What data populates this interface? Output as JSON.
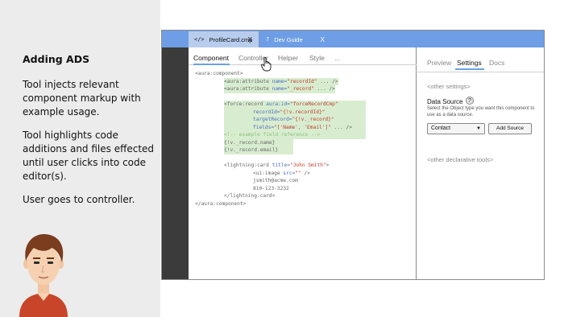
{
  "narrative": {
    "title": "Adding ADS",
    "paragraph1": "Tool injects relevant component markup with example usage.",
    "paragraph2": "Tool highlights code additions and files effected until user clicks into code editor(s).",
    "paragraph3": "User goes to controller."
  },
  "window": {
    "tabs": [
      {
        "icon": "</>",
        "label": "ProfileCard.cmp",
        "close": "X"
      },
      {
        "icon": "?",
        "label": "Dev Guide",
        "close": "X"
      }
    ]
  },
  "editor": {
    "subtabs": [
      "Component",
      "Controller",
      "Helper",
      "Style",
      "..."
    ],
    "code": {
      "l1": "<aura:component>",
      "l2a": "<aura:attribute ",
      "l2b": "name=",
      "l2c": "\"recordId\"",
      "l2d": " ... />",
      "l3a": "<aura:attribute ",
      "l3b": "name=",
      "l3c": "\"_record\"",
      "l3d": " ... />",
      "l4a": "<force:record ",
      "l4b": "aura:id=",
      "l4c": "\"forceRecordCmp\"",
      "l5a": "recordId=",
      "l5b": "\"{!v.recordId}\"",
      "l6a": "targetRecord=",
      "l6b": "\"{!v._record}\"",
      "l7a": "fields=",
      "l7b": "\"['Name', 'Email']\"",
      "l7c": " ... />",
      "l8": "<!-- example field reference -->",
      "l9": "{!v._record.name}",
      "l10": "{!v._record.email}",
      "l11a": "<lightning:card ",
      "l11b": "title=",
      "l11c": "\"John Smith\"",
      "l11d": ">",
      "l12a": "<ui:image ",
      "l12b": "src=",
      "l12c": "\"\"",
      "l12d": " />",
      "l13": "jsmith@acme.com",
      "l14": "810-123-3232",
      "l15": "</lightning:card>",
      "l16": "</aura:component>"
    }
  },
  "settings": {
    "tabs": [
      "Preview",
      "Settings",
      "Docs"
    ],
    "other_settings": "<other settings>",
    "data_source_label": "Data Source",
    "help": "?",
    "description": "Select the Object type you want this component to use as a data source.",
    "select_value": "Contact",
    "caret": "▼",
    "add_source": "Add Source",
    "other_tools": "<other declarative tools>"
  }
}
